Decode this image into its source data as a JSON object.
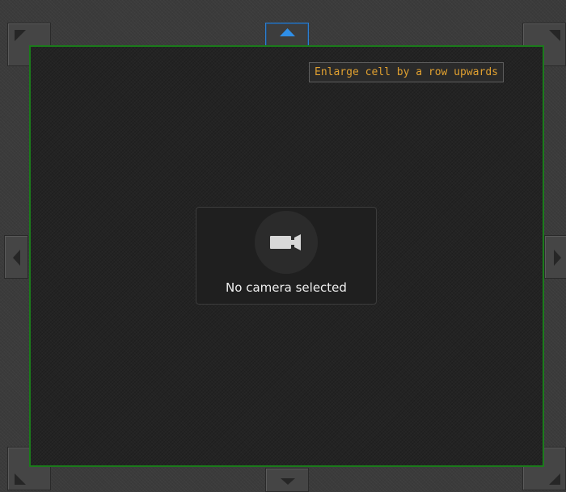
{
  "tooltip": {
    "text": "Enlarge cell by a row upwards"
  },
  "cell": {
    "status_text": "No camera selected",
    "icon": "video-camera-icon",
    "border_color": "#1b7a1b"
  },
  "controls": {
    "corner_nw": "arrow-up-left-icon",
    "corner_ne": "arrow-up-right-icon",
    "corner_sw": "arrow-down-left-icon",
    "corner_se": "arrow-down-right-icon",
    "up": "arrow-up-icon",
    "down": "arrow-down-icon",
    "left": "arrow-left-icon",
    "right": "arrow-right-icon",
    "active_color": "#2d7fd0",
    "tooltip_color": "#e0a030"
  }
}
